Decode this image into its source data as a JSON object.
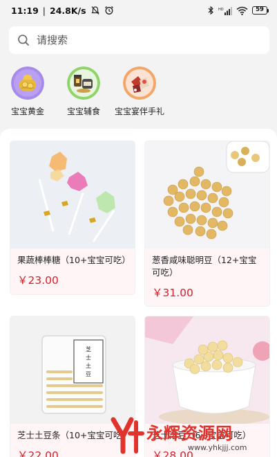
{
  "status_bar": {
    "time": "11:19",
    "speed": "24.8K/s",
    "battery": "59",
    "icons": [
      "mute-icon",
      "alarm-icon",
      "bluetooth-icon",
      "signal-icon",
      "wifi-icon",
      "battery-icon"
    ]
  },
  "search": {
    "placeholder": "请搜索",
    "value": ""
  },
  "categories": [
    {
      "label": "宝宝黄金",
      "icon": "gold-coin-icon"
    },
    {
      "label": "宝宝辅食",
      "icon": "baby-food-icon"
    },
    {
      "label": "宝宝宴伴手礼",
      "icon": "gift-icon"
    }
  ],
  "products": [
    {
      "title": "果蔬棒棒糖（10+宝宝可吃）",
      "price": "￥23.00",
      "image": "lollipop-image"
    },
    {
      "title": "葱香咸味聪明豆（12+宝宝可吃）",
      "price": "￥31.00",
      "image": "cookie-beans-image"
    },
    {
      "title": "芝士土豆条（10+宝宝可吃）",
      "price": "￥22.00",
      "image": "potato-sticks-image"
    },
    {
      "title": "芝士溶豆（6+宝宝可吃）",
      "price": "￥28.00",
      "image": "melt-beans-image"
    }
  ],
  "watermark": {
    "text": "永辉资源网",
    "url": "www.yhkjjj.com"
  },
  "colors": {
    "price": "#d31f2a",
    "card_info_bg": "#fff4f6",
    "page_bg": "#f3f3f3"
  }
}
